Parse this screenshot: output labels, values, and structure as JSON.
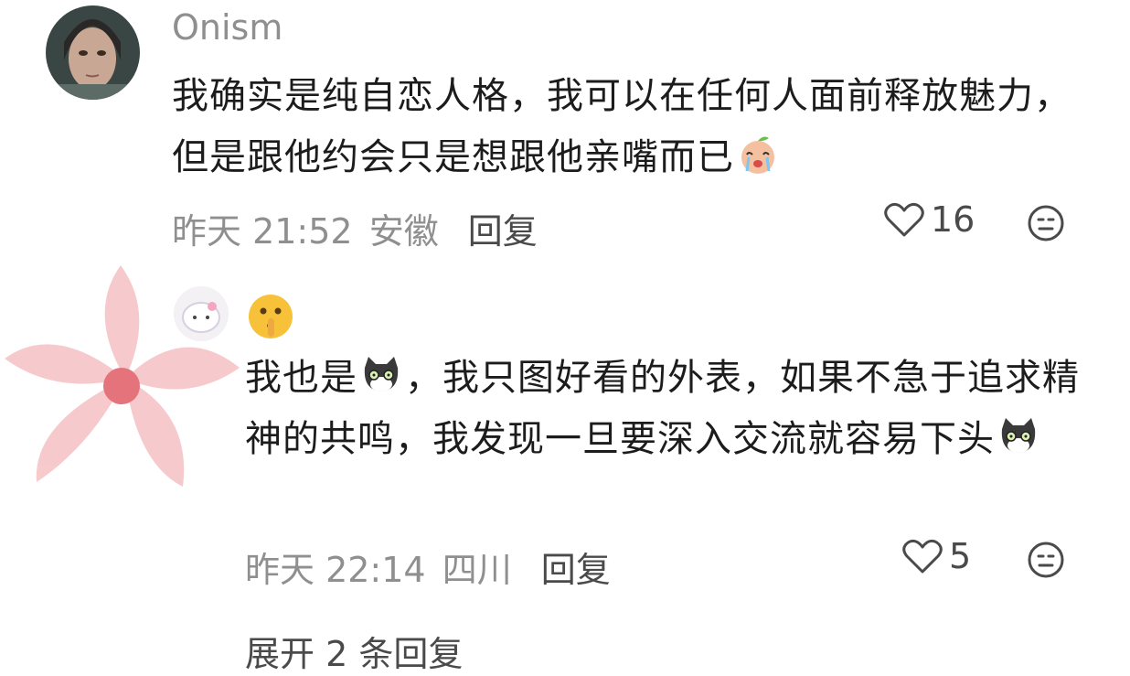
{
  "comments": [
    {
      "username": "Onism",
      "text": "我确实是纯自恋人格，我可以在任何人面前释放魅力，但是跟他约会只是想跟他亲嘴而已",
      "emoji_after_text": "crying-peach-emoji",
      "time": "昨天 21:52",
      "location": "安徽",
      "reply_label": "回复",
      "likes": "16"
    },
    {
      "username_emoji": "shushing-face-emoji",
      "text_parts": [
        "我也是",
        "，我只图好看的外表，如果不急于追求精神的共鸣，我发现一旦要深入交流就容易下头"
      ],
      "inline_emoji": "dazed-cat-emoji",
      "time": "昨天 22:14",
      "location": "四川",
      "reply_label": "回复",
      "likes": "5"
    }
  ],
  "more_replies": "展开 2 条回复",
  "colors": {
    "meta_gray": "#8f8f8f",
    "text": "#1c1c1c",
    "flower_pink": "#f6c6c8"
  },
  "icons": {
    "like": "heart-outline-icon",
    "dislike": "meh-face-icon"
  }
}
